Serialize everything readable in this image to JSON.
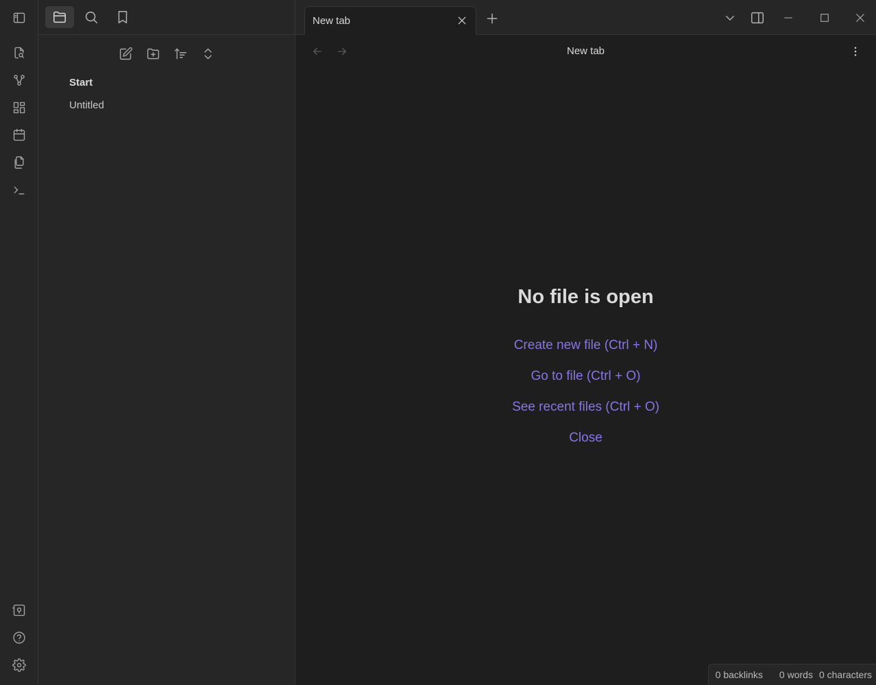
{
  "ribbon": {
    "toggle_sidebar_icon": "sidebar-left-icon",
    "items": [
      {
        "name": "quick-switcher",
        "icon": "file-search-icon"
      },
      {
        "name": "graph-view",
        "icon": "graph-icon"
      },
      {
        "name": "canvas",
        "icon": "layout-dashboard-icon"
      },
      {
        "name": "daily-note",
        "icon": "calendar-icon"
      },
      {
        "name": "templates",
        "icon": "files-icon"
      },
      {
        "name": "command-palette",
        "icon": "terminal-icon"
      }
    ],
    "bottom": [
      {
        "name": "vault-switcher",
        "icon": "vault-icon"
      },
      {
        "name": "help",
        "icon": "help-circle-icon"
      },
      {
        "name": "settings",
        "icon": "gear-icon"
      }
    ]
  },
  "sidebar": {
    "tabs": [
      {
        "name": "files",
        "icon": "folder-icon",
        "active": true
      },
      {
        "name": "search",
        "icon": "search-icon"
      },
      {
        "name": "bookmarks",
        "icon": "bookmark-icon"
      }
    ],
    "actions": [
      {
        "name": "new-note",
        "icon": "edit-icon"
      },
      {
        "name": "new-folder",
        "icon": "folder-plus-icon"
      },
      {
        "name": "sort",
        "icon": "sort-icon"
      },
      {
        "name": "collapse-all",
        "icon": "chevrons-up-down-icon"
      }
    ],
    "tree": [
      {
        "label": "Start",
        "type": "folder"
      },
      {
        "label": "Untitled",
        "type": "file"
      }
    ]
  },
  "tabbar": {
    "tabs": [
      {
        "title": "New tab",
        "active": true
      }
    ]
  },
  "view": {
    "title": "New tab",
    "empty_title": "No file is open",
    "actions": [
      {
        "label": "Create new file (Ctrl + N)"
      },
      {
        "label": "Go to file (Ctrl + O)"
      },
      {
        "label": "See recent files (Ctrl + O)"
      },
      {
        "label": "Close"
      }
    ]
  },
  "status": {
    "backlinks": "0 backlinks",
    "words": "0 words",
    "characters": "0 characters"
  },
  "colors": {
    "background": "#1e1e1e",
    "panel": "#262626",
    "accent": "#8a74e8",
    "border": "#363636"
  }
}
